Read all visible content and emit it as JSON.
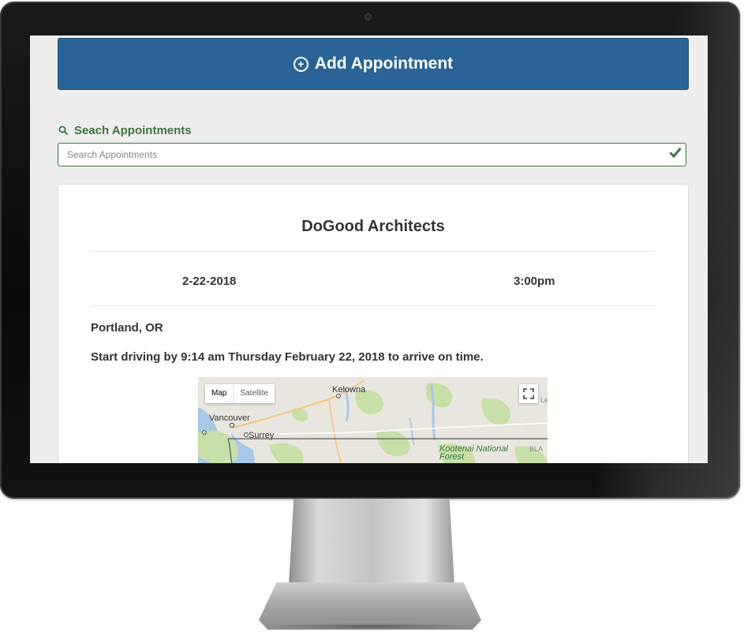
{
  "header": {
    "add_label": "Add Appointment",
    "plus_glyph": "+"
  },
  "search": {
    "label": "Seach Appointments",
    "placeholder": "Search Appointments"
  },
  "appointment": {
    "title": "DoGood Architects",
    "date": "2-22-2018",
    "time": "3:00pm",
    "location": "Portland, OR",
    "drive_notice": "Start driving by 9:14 am Thursday February 22, 2018 to arrive on time."
  },
  "map": {
    "toggle_map": "Map",
    "toggle_satellite": "Satellite",
    "places": {
      "kelowna": "Kelowna",
      "vancouver": "Vancouver",
      "surrey": "Surrey",
      "kootenai": "Kootenai National Forest",
      "edge_le": "Le",
      "edge_bla": "BLA"
    }
  },
  "colors": {
    "primary": "#2a6496",
    "success": "#3c763d",
    "screen_bg": "#eeeeee",
    "card_bg": "#ffffff"
  },
  "icons": {
    "add": "plus-circle-icon",
    "search": "search-icon",
    "valid": "check-icon",
    "fullscreen": "fullscreen-icon"
  }
}
